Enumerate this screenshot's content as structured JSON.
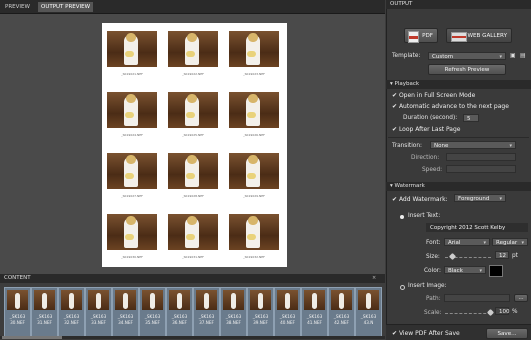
{
  "tabs": [
    {
      "label": "PREVIEW"
    },
    {
      "label": "OUTPUT PREVIEW"
    }
  ],
  "preview_captions": [
    "_SK19021.NEF",
    "_SK19022.NEF",
    "_SK19023.NEF",
    "_SK19024.NEF",
    "_SK19025.NEF",
    "_SK19026.NEF",
    "_SK19027.NEF",
    "_SK19028.NEF",
    "_SK19029.NEF",
    "_SK19030.NEF",
    "_SK19031.NEF",
    "_SK19032.NEF"
  ],
  "content": {
    "label": "CONTENT",
    "close": "×"
  },
  "strip_items": [
    {
      "n1": "_SK163",
      "n2": "30.NEF"
    },
    {
      "n1": "_SK163",
      "n2": "31.NEF"
    },
    {
      "n1": "_SK163",
      "n2": "32.NEF"
    },
    {
      "n1": "_SK163",
      "n2": "33.NEF"
    },
    {
      "n1": "_SK163",
      "n2": "34.NEF"
    },
    {
      "n1": "_SK163",
      "n2": "35.NEF"
    },
    {
      "n1": "_SK163",
      "n2": "36.NEF"
    },
    {
      "n1": "_SK163",
      "n2": "37.NEF"
    },
    {
      "n1": "_SK163",
      "n2": "38.NEF"
    },
    {
      "n1": "_SK163",
      "n2": "39.NEF"
    },
    {
      "n1": "_SK163",
      "n2": "40.NEF"
    },
    {
      "n1": "_SK163",
      "n2": "41.NEF"
    },
    {
      "n1": "_SK163",
      "n2": "42.NEF"
    },
    {
      "n1": "_SK163",
      "n2": "43.N"
    }
  ],
  "output": {
    "header": "OUTPUT",
    "pdf": "PDF",
    "web_gallery": "WEB GALLERY",
    "template_label": "Template:",
    "template_value": "Custom",
    "refresh": "Refresh Preview"
  },
  "playback": {
    "header": "Playback",
    "fullscreen": "Open in Full Screen Mode",
    "auto_advance": "Automatic advance to the next page",
    "duration_label": "Duration (second):",
    "duration_value": "5",
    "loop": "Loop After Last Page",
    "transition_label": "Transition:",
    "transition_value": "None",
    "direction_label": "Direction:",
    "speed_label": "Speed:"
  },
  "watermark": {
    "header": "Watermark",
    "add_label": "Add Watermark:",
    "add_value": "Foreground",
    "insert_text": "Insert Text:",
    "text_value": "Copyright 2012 Scott Kelby",
    "font_label": "Font:",
    "font_value": "Arial",
    "style_value": "Regular",
    "size_label": "Size:",
    "size_value": "12",
    "size_unit": "pt",
    "color_label": "Color:",
    "color_value": "Black",
    "insert_image": "Insert Image:",
    "path_label": "Path:",
    "browse": "...",
    "scale_label": "Scale:",
    "scale_value": "100",
    "scale_unit": "%"
  },
  "footer": {
    "view_pdf": "View PDF After Save",
    "save": "Save..."
  },
  "colors": {
    "accent": "#3c3c3c",
    "pdf_red": "#c0392b"
  }
}
